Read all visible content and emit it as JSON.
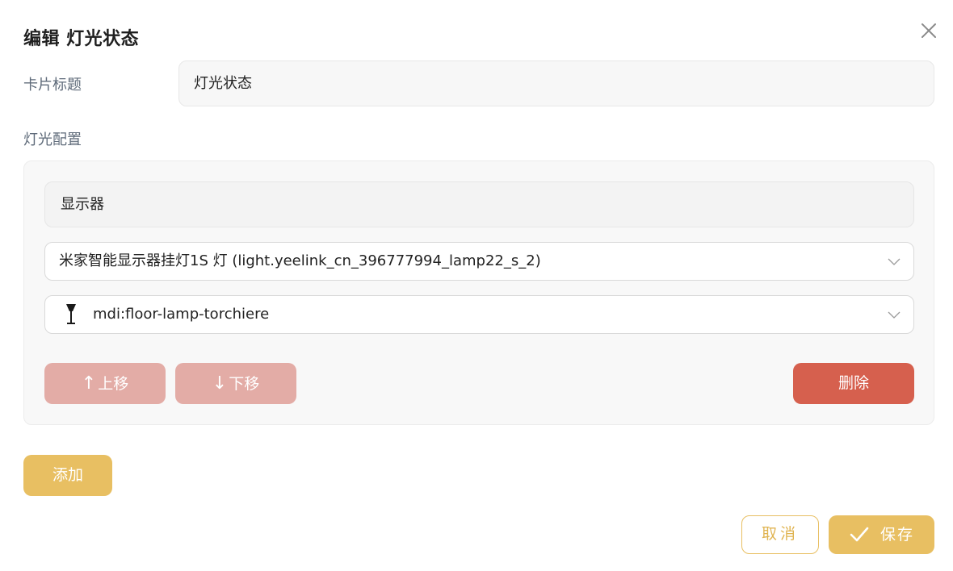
{
  "dialog": {
    "title": "编辑 灯光状态",
    "close_icon": "close-icon"
  },
  "card_title": {
    "label": "卡片标题",
    "value": "灯光状态"
  },
  "light_config": {
    "label": "灯光配置",
    "items": [
      {
        "name": "显示器",
        "entity": "米家智能显示器挂灯1S 灯 (light.yeelink_cn_396777994_lamp22_s_2)",
        "icon_name": "mdi:floor-lamp-torchiere",
        "move_up_label": "上移",
        "move_down_label": "下移",
        "delete_label": "删除"
      }
    ]
  },
  "actions": {
    "add_label": "添加",
    "cancel_label": "取消",
    "save_label": "保存"
  },
  "colors": {
    "accent": "#e8bf62",
    "danger": "#d6604e",
    "danger_muted": "#e3aca6",
    "label_text": "#5f6b7a"
  }
}
